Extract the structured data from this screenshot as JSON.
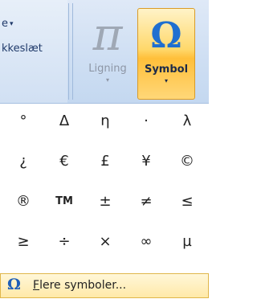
{
  "ribbon": {
    "partial_group": {
      "line1": "e",
      "line2": "kkeslæt"
    },
    "ligning_label": "Ligning",
    "symbol_label": "Symbol",
    "pi_glyph": "π",
    "omega_glyph": "Ω"
  },
  "symbols": [
    [
      "°",
      "Δ",
      "η",
      "·",
      "λ"
    ],
    [
      "¿",
      "€",
      "£",
      "¥",
      "©"
    ],
    [
      "®",
      "TM",
      "±",
      "≠",
      "≤"
    ],
    [
      "≥",
      "÷",
      "×",
      "∞",
      "µ"
    ]
  ],
  "more": {
    "icon_glyph": "Ω",
    "mnemonic": "F",
    "label_rest": "lere symboler..."
  }
}
